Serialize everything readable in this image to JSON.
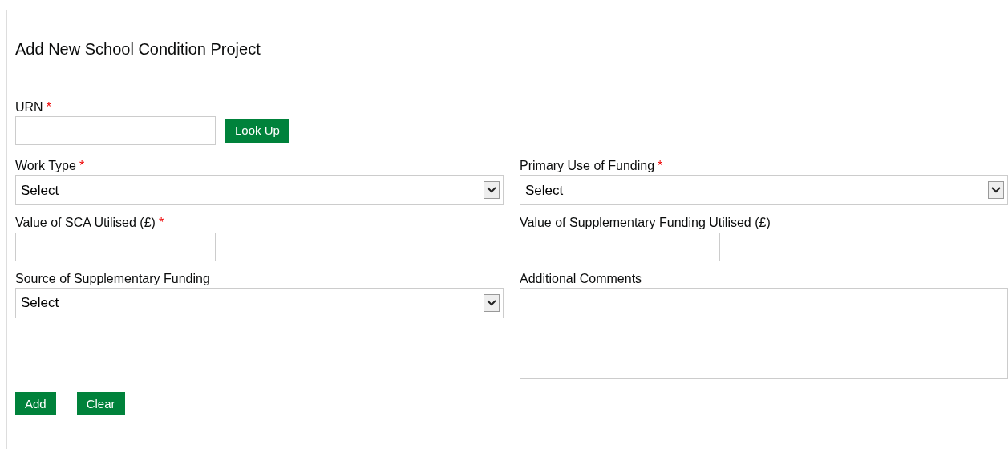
{
  "title": "Add New School Condition Project",
  "urn": {
    "label": "URN",
    "required_mark": "*",
    "button": "Look Up"
  },
  "fields": [
    {
      "kind": "select",
      "label": "Work Type",
      "required_mark": "*",
      "value": "Select"
    },
    {
      "kind": "select",
      "label": "Primary Use of Funding",
      "required_mark": "*",
      "value": "Select"
    },
    {
      "kind": "text",
      "label": "Value of SCA Utilised (£)",
      "required_mark": "*"
    },
    {
      "kind": "text",
      "label": "Value of Supplementary Funding Utilised (£)"
    },
    {
      "kind": "select",
      "label": "Source of Supplementary Funding",
      "value": "Select"
    },
    {
      "kind": "textarea",
      "label": "Additional Comments"
    }
  ],
  "buttons": [
    "Add",
    "Clear"
  ]
}
